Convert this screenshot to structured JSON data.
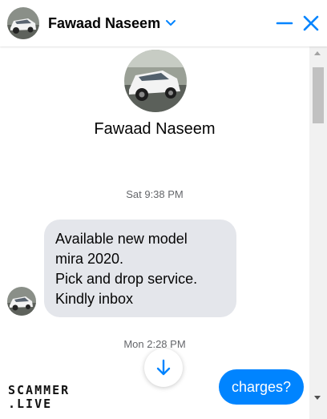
{
  "header": {
    "contact_name": "Fawaad Naseem",
    "icons": [
      "avatar",
      "chevron-down-icon",
      "minimize-icon",
      "close-icon"
    ]
  },
  "profile": {
    "name": "Fawaad Naseem"
  },
  "messages": {
    "timestamp_1": "Sat 9:38 PM",
    "incoming": {
      "lines": [
        "Available new model",
        "mira 2020.",
        "Pick and drop service.",
        "Kindly inbox"
      ]
    },
    "timestamp_2": "Mon 2:28 PM",
    "outgoing": {
      "text": "charges?"
    }
  },
  "watermark": {
    "line1": "SCAMMER",
    "line2": ".LIVE"
  },
  "colors": {
    "accent": "#0084ff",
    "incoming_bubble": "#e4e6eb",
    "timestamp": "#65676b"
  }
}
